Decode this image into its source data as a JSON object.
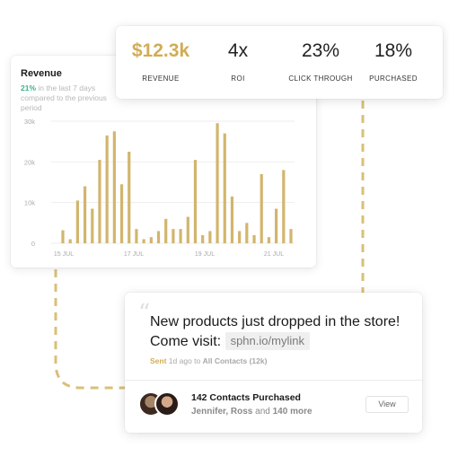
{
  "stats": [
    {
      "value": "$12.3k",
      "label": "REVENUE",
      "accent": true
    },
    {
      "value": "4x",
      "label": "ROI",
      "accent": false
    },
    {
      "value": "23%",
      "label": "CLICK THROUGH",
      "accent": false
    },
    {
      "value": "18%",
      "label": "PURCHASED",
      "accent": false
    }
  ],
  "revenue": {
    "title": "Revenue",
    "change_pct": "21%",
    "change_text": "in the last 7 days compared to the previous period"
  },
  "chart_data": {
    "type": "bar",
    "title": "Revenue",
    "y_tick_labels": [
      "30k",
      "20k",
      "10k",
      "0"
    ],
    "x_tick_labels": [
      "15 JUL",
      "17 JUL",
      "19 JUL",
      "21 JUL"
    ],
    "ylim": [
      0,
      30000
    ],
    "grid": true,
    "bar_color": "#d2b56d",
    "values": [
      3200,
      1000,
      10500,
      14000,
      8500,
      20500,
      26500,
      27500,
      14500,
      22500,
      3500,
      1000,
      1500,
      3000,
      6000,
      3500,
      3500,
      6500,
      20500,
      2000,
      3000,
      29500,
      27000,
      11500,
      3000,
      5000,
      2000,
      17000,
      1500,
      8500,
      18000,
      3500
    ]
  },
  "message": {
    "text": "New products just dropped in the store! Come visit:",
    "link": "sphn.io/mylink",
    "sent_label": "Sent",
    "meta_text": "1d ago to",
    "audience": "All Contacts (12k)"
  },
  "purchased": {
    "title": "142 Contacts Purchased",
    "names": "Jennifer, Ross",
    "and_text": "and",
    "count_text": "140 more",
    "view_label": "View"
  },
  "colors": {
    "accent": "#d2ac55",
    "positive": "#3ab28a"
  }
}
